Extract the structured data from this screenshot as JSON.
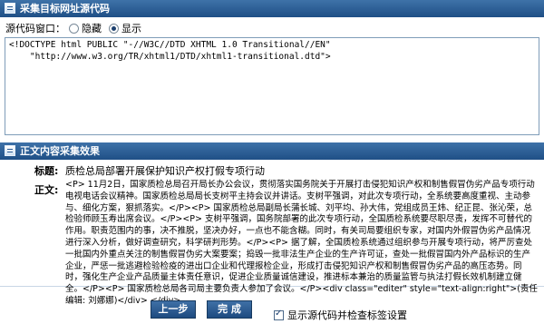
{
  "source_panel": {
    "title": "采集目标网址源代码",
    "window_label": "源代码窗口：",
    "radio_hide": "隐藏",
    "radio_show": "显示",
    "selected": "show",
    "code": "<!DOCTYPE html PUBLIC \"-//W3C//DTD XHTML 1.0 Transitional//EN\"\n    \"http://www.w3.org/TR/xhtml1/DTD/xhtml1-transitional.dtd\">"
  },
  "result_panel": {
    "title": "正文内容采集效果",
    "title_label": "标题:",
    "title_value": "质检总局部署开展保护知识产权打假专项行动",
    "body_label": "正文:",
    "body_value": "<P>    11月2日，国家质检总局召开局长办公会议，贯彻落实国务院关于开展打击侵犯知识产权和制售假冒伪劣产品专项行动电视电话会议精神。国家质检总局局长支树平主持会议并讲话。支树平强调，对此次专项行动，全系统要高度重视、主动参与、细化方案，狠抓落实。</P><P>    国家质检总局副局长蒲长城、刘平均、孙大伟，党组成员王炜、纪正昆、张沁荣，总检验师顾玉寿出席会议。</P><P>    支树平强调，国务院部署的此次专项行动，全国质检系统要尽职尽责，发挥不可替代的作用。职责范围内的事，决不推脱，坚决办好，一点也不能含糊。同时，有关司局要组织专家，对国内外假冒伪劣产品情况进行深入分析，做好调查研究，科学研判形势。</P><P>    据了解，全国质检系统通过组织参与开展专项行动，将严厉查处一批国内外重点关注的制售假冒伪劣大案要案；捣毁一批非法生产企业的生产许可证，查处一批假冒国内外产品标识的生产企业，严惩一批逃避检验检疫的进出口企业和代理报检企业，形成打击侵犯知识产权和制售假冒伪劣产品的高压态势。同时，强化生产企业产品质量主体责任意识，促进企业质量诚信建设，推进标本兼治的质量监管与执法打假长效机制建立健全。</P><P>    国家质检总局各司局主要负责人参加了会议。</P><div class=\"editer\" style=\"text-align:right\">(责任编辑: 刘娜娜)</div> </div>"
  },
  "footer": {
    "prev_label": "上一步",
    "finish_label": "完 成",
    "show_source_label": "显示源代码并检查标签设置",
    "show_source_checked": true
  }
}
